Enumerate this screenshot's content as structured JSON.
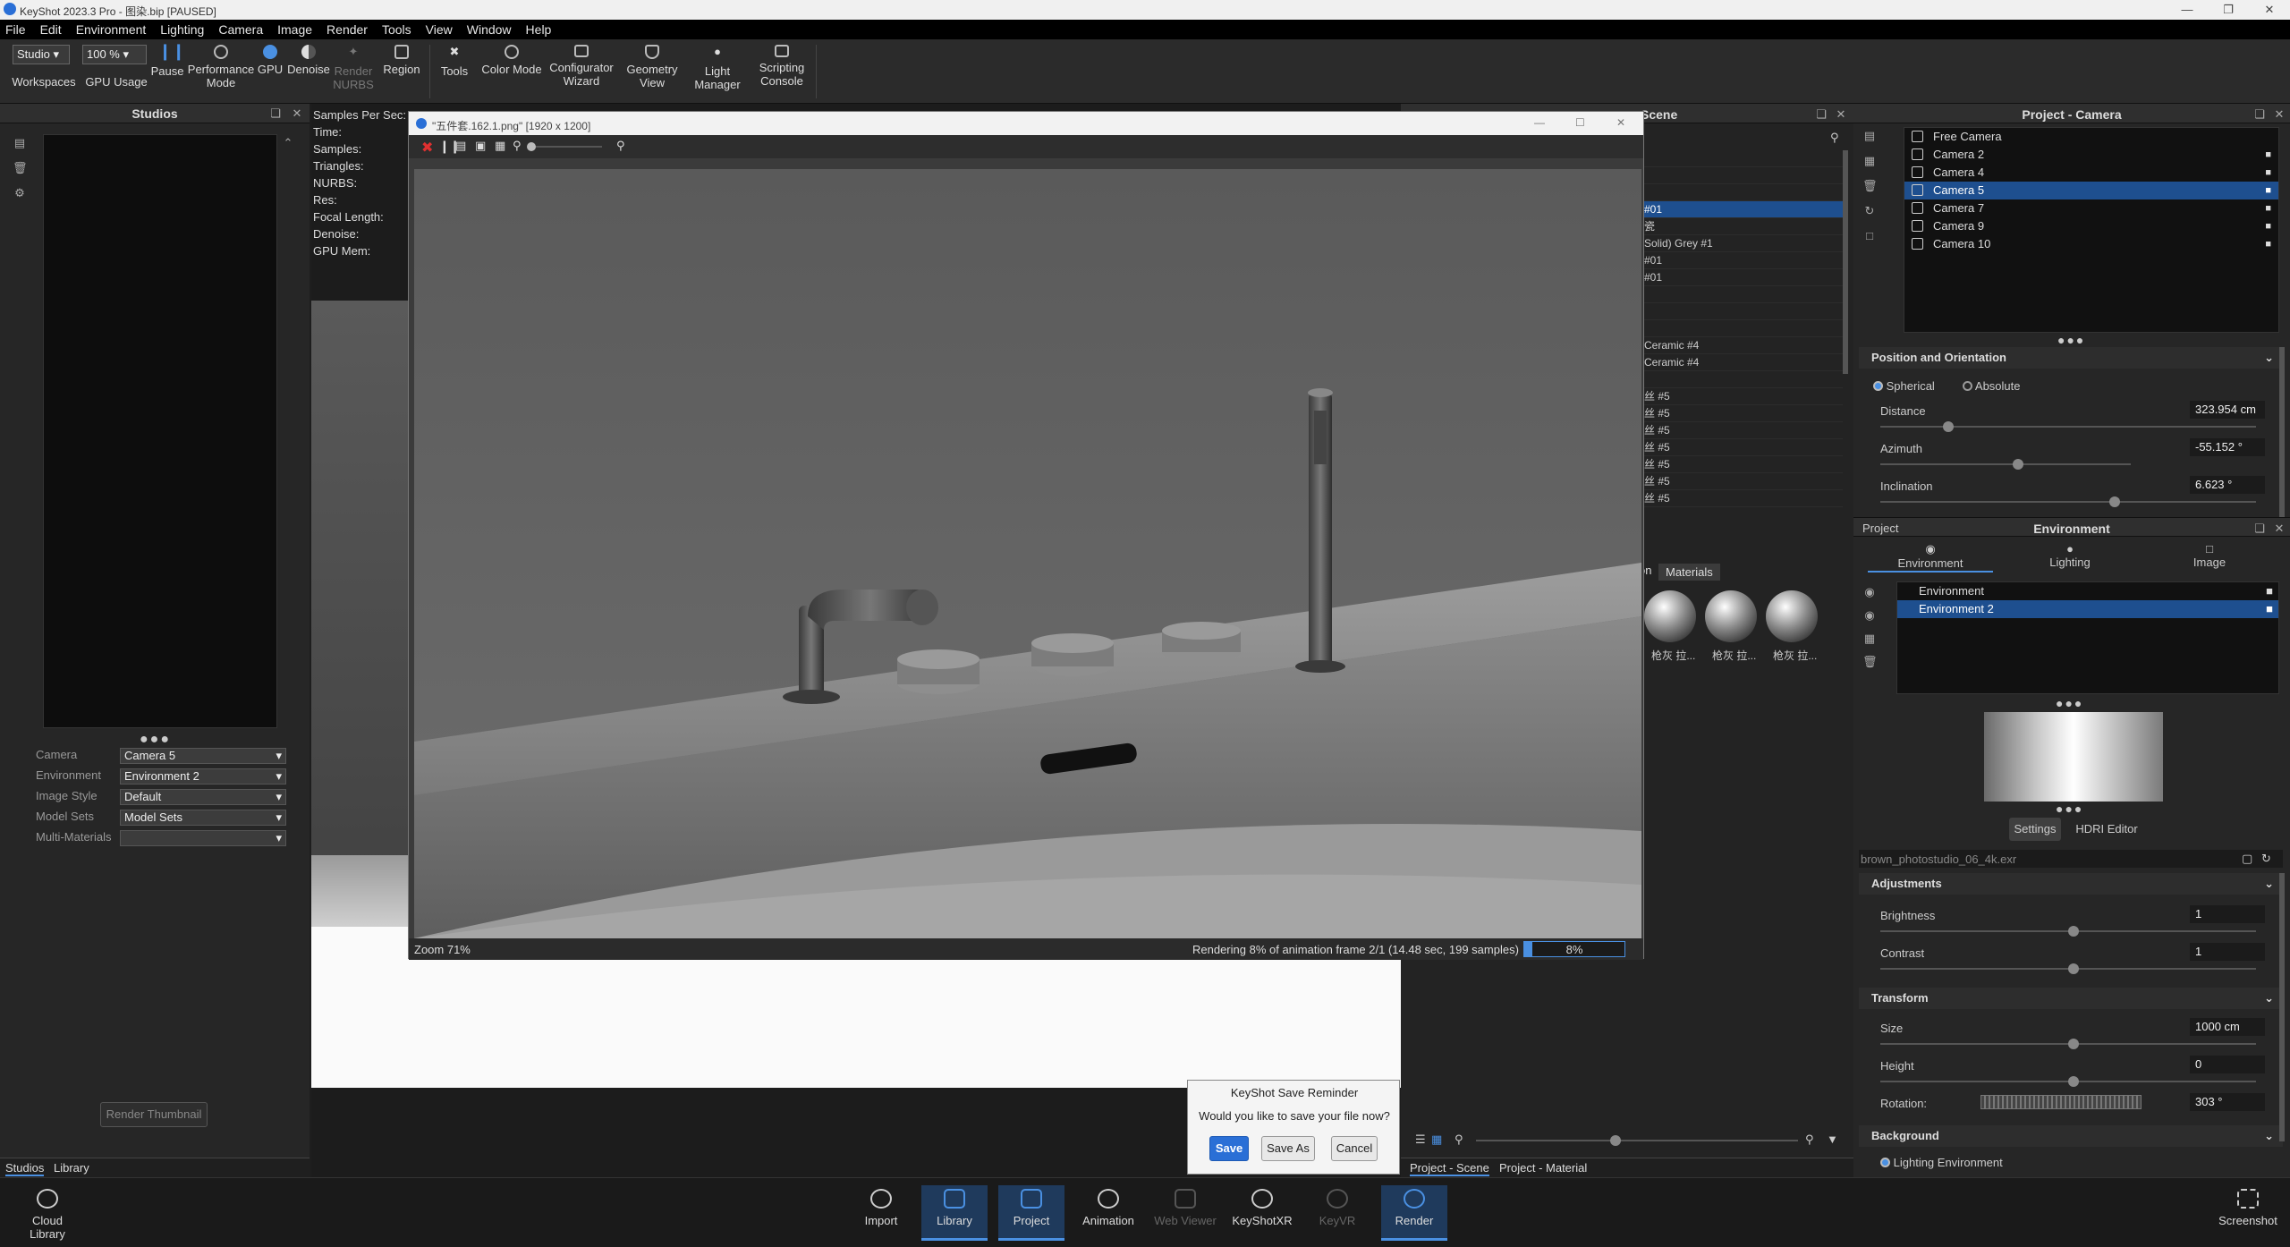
{
  "titlebar": {
    "title": "KeyShot 2023.3 Pro  - 图染.bip [PAUSED]"
  },
  "menu": [
    "File",
    "Edit",
    "Environment",
    "Lighting",
    "Camera",
    "Image",
    "Render",
    "Tools",
    "View",
    "Window",
    "Help"
  ],
  "ribbon": {
    "workspace_select": "Studio",
    "zoom_select": "100 %",
    "buttons": {
      "workspaces": "Workspaces",
      "gpu_usage": "GPU Usage",
      "pause": "Pause",
      "performance_mode": "Performance Mode",
      "gpu": "GPU",
      "denoise": "Denoise",
      "render_nurbs": "Render NURBS",
      "region": "Region",
      "tools": "Tools",
      "color_mode": "Color Mode",
      "configurator_wizard": "Configurator Wizard",
      "geometry_view": "Geometry View",
      "light_manager": "Light Manager",
      "scripting_console": "Scripting Console"
    }
  },
  "studios": {
    "title": "Studios",
    "rows": [
      {
        "label": "Camera",
        "value": "Camera 5"
      },
      {
        "label": "Environment",
        "value": "Environment 2"
      },
      {
        "label": "Image Style",
        "value": "Default"
      },
      {
        "label": "Model Sets",
        "value": "Model Sets"
      },
      {
        "label": "Multi-Materials",
        "value": ""
      }
    ],
    "render_thumbnail": "Render Thumbnail",
    "tabs": [
      "Studios",
      "Library"
    ]
  },
  "viewport_info": [
    "Samples Per Sec:",
    "Time:",
    "Samples:",
    "Triangles:",
    "NURBS:",
    "Res:",
    "Focal Length:",
    "Denoise:",
    "GPU Mem:"
  ],
  "render_window": {
    "title": "\"五件套.162.1.png\" [1920 x 1200]",
    "zoom": "Zoom 71%",
    "status": "Rendering 8% of animation frame 2/1 (14.48 sec, 199 samples)",
    "progress_label": "8%",
    "progress": 0.08
  },
  "scene": {
    "title": "Scene",
    "rows": [
      {
        "text": "",
        "sel": false
      },
      {
        "text": "",
        "sel": false
      },
      {
        "text": "",
        "sel": false
      },
      {
        "text": "#01",
        "sel": true
      },
      {
        "text": "瓷",
        "sel": false
      },
      {
        "text": "Solid) Grey #1",
        "sel": false
      },
      {
        "text": "#01",
        "sel": false
      },
      {
        "text": "#01",
        "sel": false
      },
      {
        "text": "",
        "sel": false
      },
      {
        "text": "",
        "sel": false
      },
      {
        "text": "",
        "sel": false
      },
      {
        "text": "Ceramic #4",
        "sel": false
      },
      {
        "text": "Ceramic #4",
        "sel": false
      },
      {
        "text": "",
        "sel": false
      },
      {
        "text": "丝 #5",
        "sel": false
      },
      {
        "text": "丝 #5",
        "sel": false
      },
      {
        "text": "丝 #5",
        "sel": false
      },
      {
        "text": "丝 #5",
        "sel": false
      },
      {
        "text": "丝 #5",
        "sel": false
      },
      {
        "text": "丝 #5",
        "sel": false
      },
      {
        "text": "丝 #5",
        "sel": false
      }
    ],
    "tabs": [
      "on",
      "Materials"
    ],
    "materials": [
      "枪灰 拉...",
      "枪灰 拉...",
      "枪灰 拉..."
    ],
    "bottom_tabs": [
      "Project - Scene",
      "Project - Material"
    ]
  },
  "camera_panel": {
    "title": "Project - Camera",
    "cameras": [
      {
        "name": "Free Camera",
        "sel": false,
        "lock": false
      },
      {
        "name": "Camera 2",
        "sel": false,
        "lock": true
      },
      {
        "name": "Camera 4",
        "sel": false,
        "lock": true
      },
      {
        "name": "Camera 5",
        "sel": true,
        "lock": true
      },
      {
        "name": "Camera 7",
        "sel": false,
        "lock": true
      },
      {
        "name": "Camera 9",
        "sel": false,
        "lock": true
      },
      {
        "name": "Camera 10",
        "sel": false,
        "lock": true
      }
    ],
    "position_orientation": "Position and Orientation",
    "spherical": "Spherical",
    "absolute": "Absolute",
    "distance_label": "Distance",
    "distance": "323.954 cm",
    "azimuth_label": "Azimuth",
    "azimuth": "-55.152 °",
    "inclination_label": "Inclination",
    "inclination": "6.623 °"
  },
  "environment_panel": {
    "project": "Project",
    "title": "Environment",
    "tabs": [
      "Environment",
      "Lighting",
      "Image"
    ],
    "items": [
      {
        "name": "Environment",
        "sel": false
      },
      {
        "name": "Environment 2",
        "sel": true
      }
    ],
    "settings_tab": "Settings",
    "hdri_tab": "HDRI Editor",
    "file": "brown_photostudio_06_4k.exr",
    "adjustments": "Adjustments",
    "brightness_label": "Brightness",
    "brightness": "1",
    "contrast_label": "Contrast",
    "contrast": "1",
    "transform": "Transform",
    "size_label": "Size",
    "size": "1000 cm",
    "height_label": "Height",
    "height": "0",
    "rotation_label": "Rotation:",
    "rotation": "303 °",
    "background": "Background",
    "lighting_environment": "Lighting Environment"
  },
  "bottombar": {
    "cloud_library": "Cloud Library",
    "import": "Import",
    "library": "Library",
    "project": "Project",
    "animation": "Animation",
    "web_viewer": "Web Viewer",
    "keyshotxr": "KeyShotXR",
    "keyvr": "KeyVR",
    "render": "Render",
    "screenshot": "Screenshot"
  },
  "reminder": {
    "title": "KeyShot Save Reminder",
    "message": "Would you like to save your file now?",
    "save": "Save",
    "save_as": "Save As",
    "cancel": "Cancel"
  }
}
